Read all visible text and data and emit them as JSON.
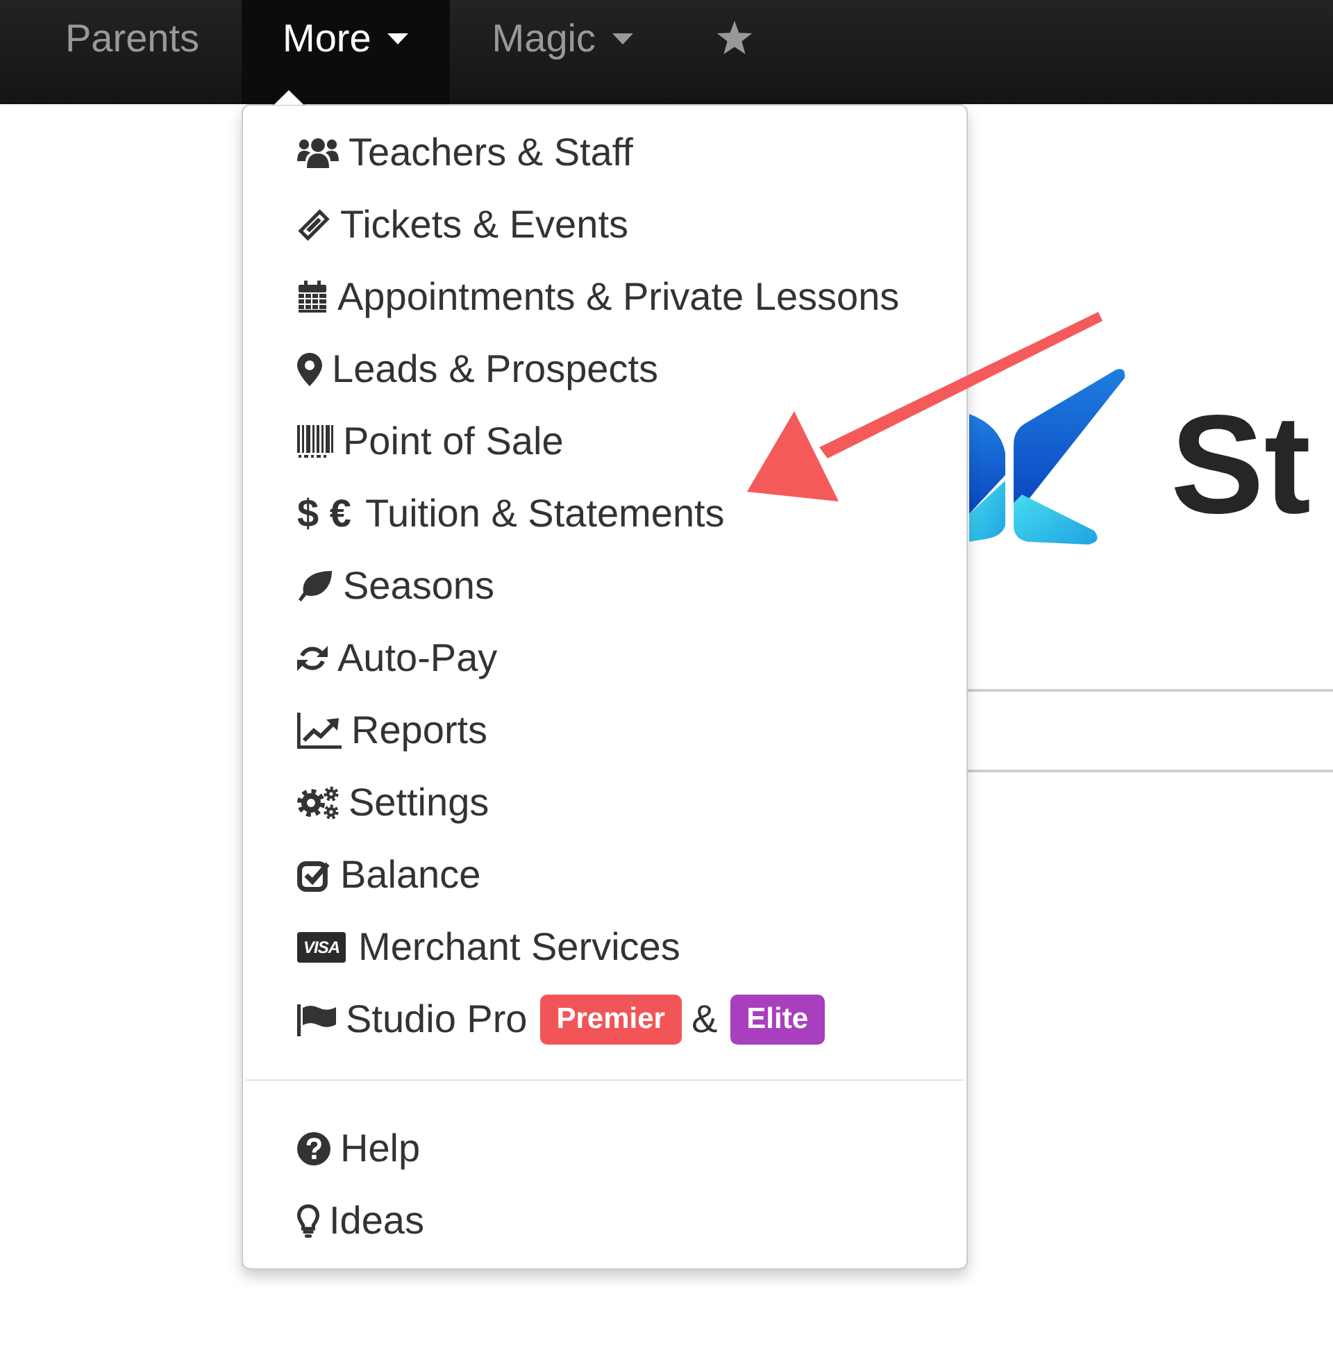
{
  "navbar": {
    "items": [
      {
        "kind": "text",
        "label": "Parents",
        "selected": false,
        "dropdown": false
      },
      {
        "kind": "text",
        "label": "More",
        "selected": true,
        "dropdown": true
      },
      {
        "kind": "text",
        "label": "Magic",
        "selected": false,
        "dropdown": true
      },
      {
        "kind": "icon",
        "selected": false
      }
    ]
  },
  "menu": {
    "sections": [
      {
        "items": [
          {
            "label": "Teachers & Staff"
          },
          {
            "label": "Tickets & Events"
          },
          {
            "label": "Appointments & Private Lessons"
          },
          {
            "label": "Leads & Prospects"
          },
          {
            "label": "Point of Sale"
          },
          {
            "symbol": "$ €",
            "label": "Tuition & Statements"
          },
          {
            "label": "Seasons"
          },
          {
            "label": "Auto-Pay"
          },
          {
            "label": "Reports"
          },
          {
            "label": "Settings"
          },
          {
            "label": "Balance"
          },
          {
            "card_text": "VISA",
            "label": "Merchant Services"
          },
          {
            "label": "Studio Pro",
            "extras": [
              {
                "kind": "badge",
                "text": "Premier",
                "color": "#f25558"
              },
              {
                "kind": "text",
                "text": "&"
              },
              {
                "kind": "badge",
                "text": "Elite",
                "color": "#a83fbe"
              }
            ]
          }
        ]
      },
      {
        "items": [
          {
            "label": "Help"
          },
          {
            "label": "Ideas"
          }
        ]
      }
    ]
  },
  "page": {
    "logo": {
      "text": "St"
    }
  }
}
